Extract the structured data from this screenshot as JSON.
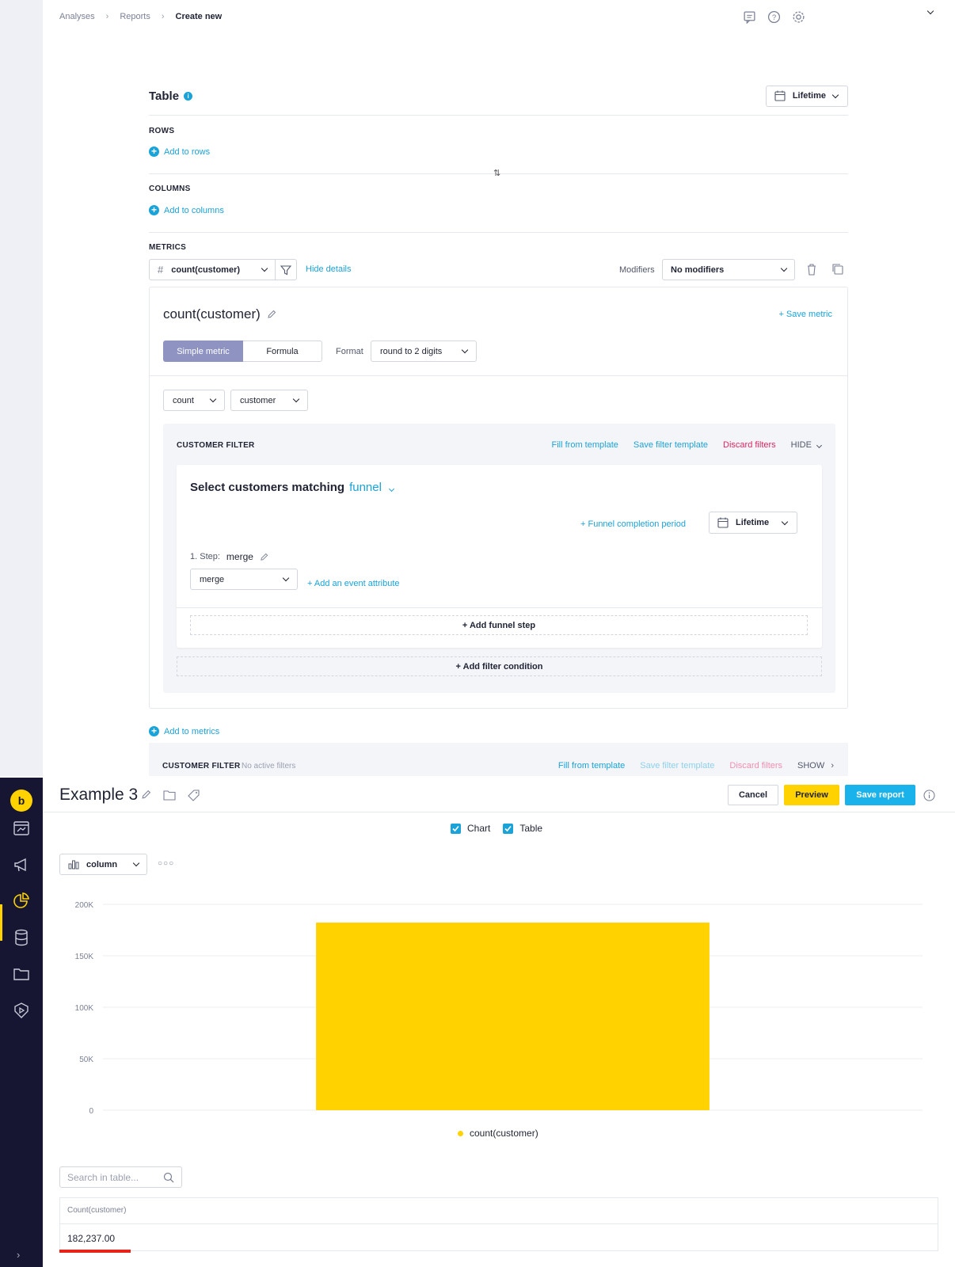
{
  "breadcrumb": [
    "Analyses",
    "Reports",
    "Create new"
  ],
  "panel": {
    "title": "Table",
    "date_range": "Lifetime",
    "rows_label": "ROWS",
    "rows_add": "Add to rows",
    "columns_label": "COLUMNS",
    "columns_add": "Add to columns",
    "metrics_label": "METRICS",
    "metric_select": "count(customer)",
    "hide_details": "Hide details",
    "modifiers_label": "Modifiers",
    "modifiers_value": "No modifiers"
  },
  "metric_card": {
    "name": "count(customer)",
    "save_metric": "+ Save metric",
    "tab_simple": "Simple metric",
    "tab_formula": "Formula",
    "format_label": "Format",
    "format_value": "round to 2 digits",
    "aggregation": "count",
    "target": "customer"
  },
  "customer_filter": {
    "title": "CUSTOMER FILTER",
    "fill_template": "Fill from template",
    "save_template": "Save filter template",
    "discard": "Discard filters",
    "hide": "HIDE",
    "select_label": "Select customers matching",
    "select_type": "funnel",
    "funnel_period": "+ Funnel completion period",
    "funnel_date": "Lifetime",
    "step_label": "1. Step:",
    "step_value": "merge",
    "event_select": "merge",
    "add_attr": "+ Add an event attribute",
    "add_step": "+ Add funnel step",
    "add_condition": "+ Add filter condition"
  },
  "add_metrics": "Add to metrics",
  "bottom_filter": {
    "title": "CUSTOMER FILTER",
    "status": "No active filters",
    "fill_template": "Fill from template",
    "save_template": "Save filter template",
    "discard": "Discard filters",
    "show": "SHOW"
  },
  "header": {
    "title": "Example 3",
    "cancel": "Cancel",
    "preview": "Preview",
    "save": "Save report"
  },
  "view_toggles": {
    "chart": "Chart",
    "table": "Table",
    "chart_checked": true,
    "table_checked": true
  },
  "chart_type": "column",
  "chart_data": {
    "type": "bar",
    "categories": [
      ""
    ],
    "series": [
      {
        "name": "count(customer)",
        "values": [
          182237
        ]
      }
    ],
    "ylim": [
      0,
      200000
    ],
    "yticks": [
      0,
      50000,
      100000,
      150000,
      200000
    ],
    "ytick_labels": [
      "0",
      "50K",
      "100K",
      "150K",
      "200K"
    ],
    "grid": true,
    "color": "#FFD200",
    "legend": "bottom-center"
  },
  "table": {
    "search_placeholder": "Search in table...",
    "header": "Count(customer)",
    "value": "182,237.00"
  },
  "colors": {
    "accent": "#1aa3d9",
    "danger": "#e0245e",
    "brand": "#ffd200",
    "sidebar": "#161632"
  }
}
